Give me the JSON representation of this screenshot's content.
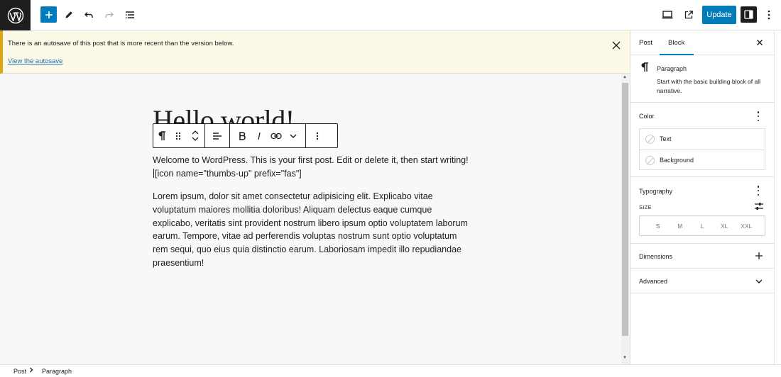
{
  "topbar": {
    "update_label": "Update"
  },
  "notice": {
    "message": "There is an autosave of this post that is more recent than the version below.",
    "link_label": "View the autosave"
  },
  "editor": {
    "title": "Hello world!",
    "paragraph1_before_caret": "Welcome to WordPress. This is your first post. Edit or delete it, then start writing! ",
    "paragraph1_after_caret": "[icon name=\"thumbs-up\" prefix=\"fas\"]",
    "paragraph2": "Lorem ipsum, dolor sit amet consectetur adipisicing elit. Explicabo vitae voluptatum maiores mollitia doloribus! Aliquam delectus eaque cumque explicabo, veritatis sint provident nostrum libero ipsum optio voluptatem laborum earum. Tempore, vitae ad perferendis voluptas nostrum sunt optio voluptatum rem sequi, quo eius quia distinctio earum. Laboriosam impedit illo repudiandae praesentium!"
  },
  "footer": {
    "breadcrumbs": [
      "Post",
      "Paragraph"
    ]
  },
  "sidebar": {
    "tabs": [
      {
        "label": "Post",
        "active": false
      },
      {
        "label": "Block",
        "active": true
      }
    ],
    "block_card": {
      "title": "Paragraph",
      "description": "Start with the basic building block of all narrative."
    },
    "color": {
      "title": "Color",
      "items": [
        "Text",
        "Background"
      ]
    },
    "typography": {
      "title": "Typography",
      "size_label": "SIZE",
      "sizes": [
        "S",
        "M",
        "L",
        "XL",
        "XXL"
      ]
    },
    "dimensions": {
      "title": "Dimensions"
    },
    "advanced": {
      "title": "Advanced"
    }
  },
  "colors": {
    "accent": "#007cba",
    "dark": "#1e1e1e",
    "notice_bg": "#fcf9e8",
    "notice_border": "#dba617",
    "link": "#2271b1"
  }
}
